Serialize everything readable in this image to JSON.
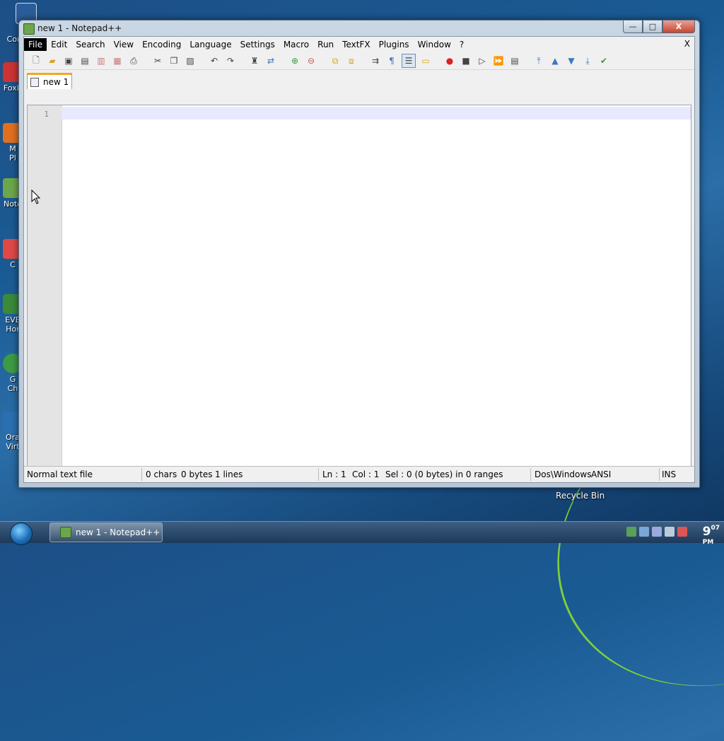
{
  "desktop": {
    "icons": [
      {
        "label": "My Computer"
      },
      {
        "label": "Foxit"
      },
      {
        "label": "M\nPl"
      },
      {
        "label": "Note"
      },
      {
        "label": "C"
      },
      {
        "label": "EVE\nHor"
      },
      {
        "label": "G\nCh"
      },
      {
        "label": "Ora\nVirt"
      }
    ],
    "recycle_bin": "Recycle Bin"
  },
  "window": {
    "title": "new  1 - Notepad++",
    "controls": {
      "minimize": "—",
      "maximize": "□",
      "close": "X"
    }
  },
  "menu": {
    "items": [
      "File",
      "Edit",
      "Search",
      "View",
      "Encoding",
      "Language",
      "Settings",
      "Macro",
      "Run",
      "TextFX",
      "Plugins",
      "Window",
      "?"
    ],
    "close": "X"
  },
  "toolbar": {
    "icons": [
      "new-file-icon",
      "open-file-icon",
      "save-icon",
      "save-all-icon",
      "close-icon",
      "close-all-icon",
      "print-icon",
      "cut-icon",
      "copy-icon",
      "paste-icon",
      "undo-icon",
      "redo-icon",
      "find-icon",
      "replace-icon",
      "zoom-in-icon",
      "zoom-out-icon",
      "sync-vertical-icon",
      "sync-horizontal-icon",
      "word-wrap-icon",
      "show-all-chars-icon",
      "indent-guide-icon",
      "doc-map-icon",
      "record-macro-icon",
      "stop-record-icon",
      "play-macro-icon",
      "run-macro-multiple-icon",
      "save-macro-icon",
      "top-icon",
      "up-icon",
      "down-icon",
      "bottom-icon",
      "spellcheck-icon"
    ]
  },
  "tabs": [
    {
      "label": "new  1"
    }
  ],
  "editor": {
    "line_numbers": [
      "1"
    ]
  },
  "status": {
    "file_type": "Normal text file",
    "chars": "0 chars",
    "bytes": "0 bytes",
    "lines": "1 lines",
    "ln": "Ln : 1",
    "col": "Col : 1",
    "sel": "Sel : 0 (0 bytes) in 0 ranges",
    "eol": "Dos\\Windows",
    "encoding": "ANSI",
    "mode": "INS"
  },
  "taskbar": {
    "task_label": "new  1 - Notepad++",
    "clock_hour": "9",
    "clock_min": "07",
    "clock_ampm": "PM"
  }
}
